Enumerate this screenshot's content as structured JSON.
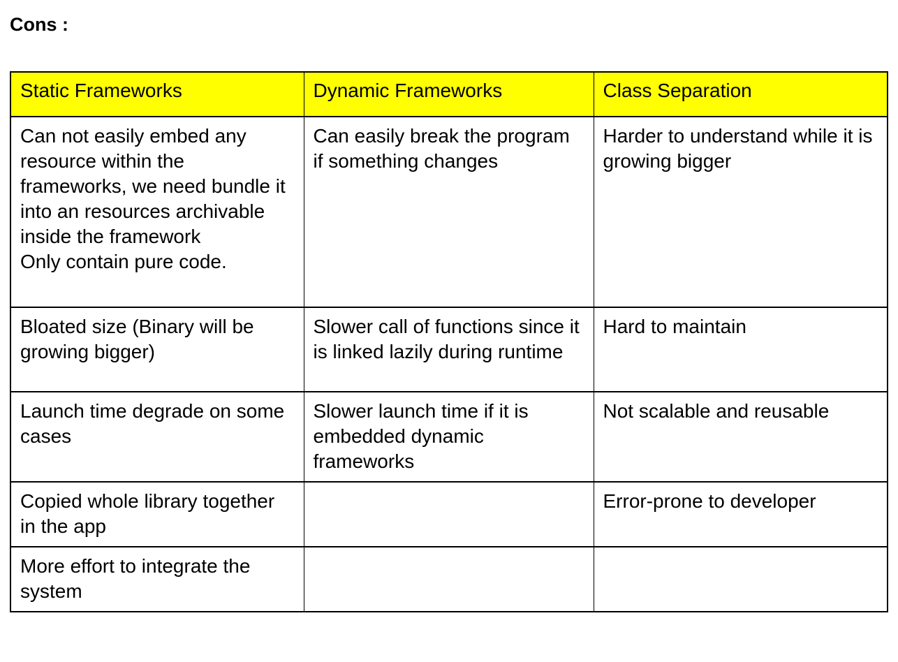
{
  "section": {
    "title": "Cons :"
  },
  "table": {
    "headers": [
      "Static Frameworks",
      "Dynamic Frameworks",
      "Class Separation"
    ],
    "header_background": "#ffff00",
    "border_color": "#000000",
    "rows": [
      {
        "static": "Can not easily embed any resource within the frameworks, we need bundle it into an resources archivable inside the framework",
        "static_second": "Only contain pure code.",
        "dynamic": "Can easily break the program if something changes",
        "separation": "Harder to understand while it is growing bigger"
      },
      {
        "static": "Bloated size (Binary will be growing bigger)",
        "static_second": "",
        "dynamic": "Slower call of functions since it is linked lazily during runtime",
        "separation": "Hard to maintain"
      },
      {
        "static": "Launch time degrade on some cases",
        "static_second": "",
        "dynamic": "Slower launch time if it is embedded dynamic frameworks",
        "separation": "Not scalable and reusable"
      },
      {
        "static": "Copied whole library together in the app",
        "static_second": "",
        "dynamic": "",
        "separation": "Error-prone to developer"
      },
      {
        "static": "More effort to integrate the system",
        "static_second": "",
        "dynamic": "",
        "separation": ""
      }
    ]
  }
}
